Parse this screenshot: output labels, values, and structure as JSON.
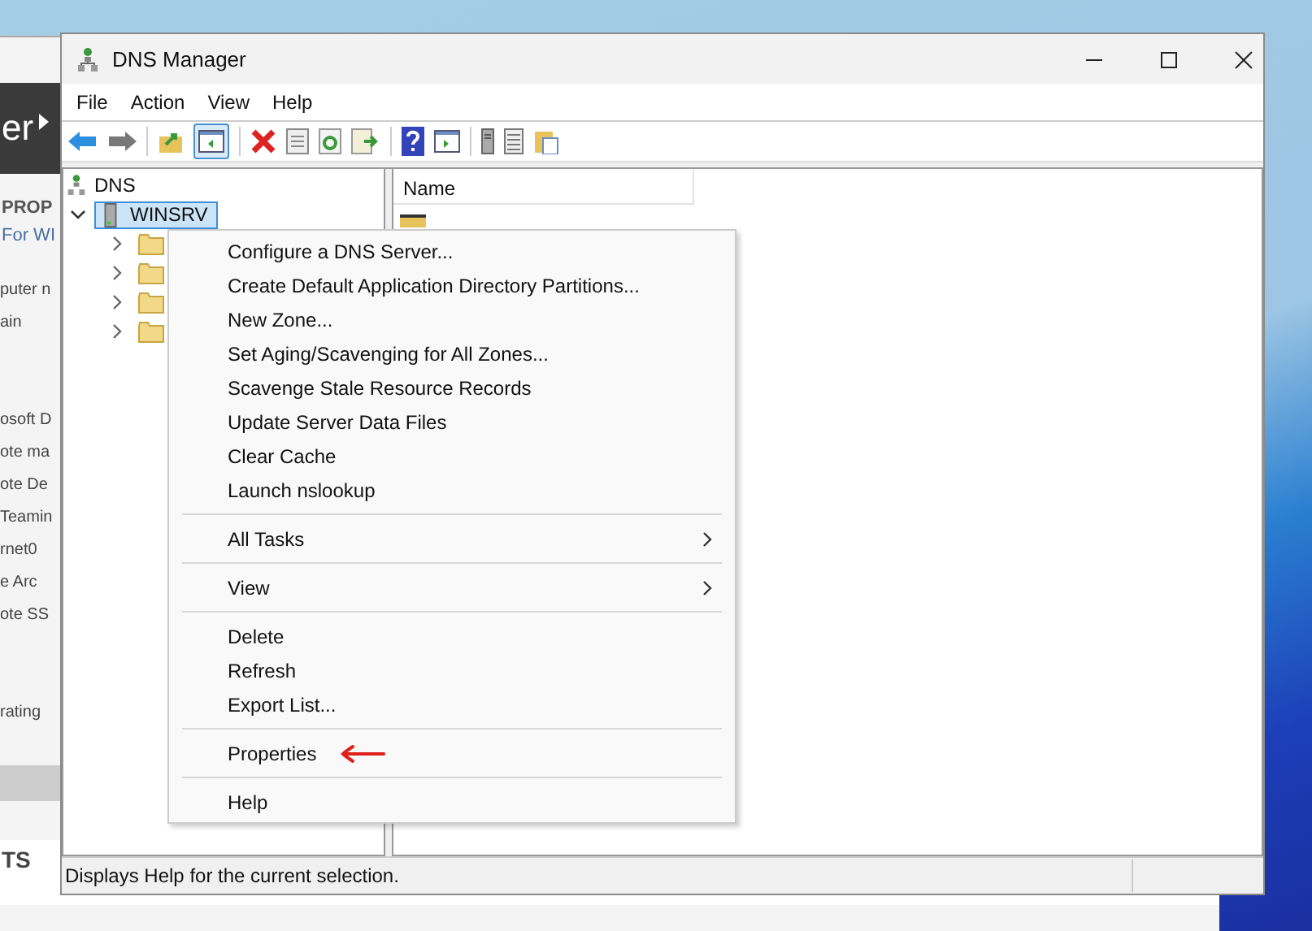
{
  "background_window": {
    "header": "er",
    "section_title": "PROP",
    "subtitle": "For WI",
    "line_groups": [
      [
        "puter n",
        "ain"
      ],
      [
        "osoft D",
        "ote ma",
        "ote De",
        "Teamin",
        "rnet0",
        "e Arc",
        "ote SS"
      ],
      [
        "rating"
      ]
    ],
    "footer_title": "TS"
  },
  "window": {
    "title": "DNS Manager"
  },
  "menu_bar": [
    "File",
    "Action",
    "View",
    "Help"
  ],
  "tree": {
    "label": "DNS",
    "children": [
      {
        "label": "WINSRV",
        "selected": true,
        "expanded": true,
        "children": [
          {
            "expanded": false
          },
          {
            "expanded": false
          },
          {
            "expanded": false
          },
          {
            "expanded": false
          }
        ]
      }
    ]
  },
  "list": {
    "columns": [
      "Name"
    ]
  },
  "context_menu": {
    "groups": [
      [
        {
          "label": "Configure a DNS Server...",
          "submenu": false,
          "marked": false
        },
        {
          "label": "Create Default Application Directory Partitions...",
          "submenu": false,
          "marked": false
        },
        {
          "label": "New Zone...",
          "submenu": false,
          "marked": false
        },
        {
          "label": "Set Aging/Scavenging for All Zones...",
          "submenu": false,
          "marked": false
        },
        {
          "label": "Scavenge Stale Resource Records",
          "submenu": false,
          "marked": false
        },
        {
          "label": "Update Server Data Files",
          "submenu": false,
          "marked": false
        },
        {
          "label": "Clear Cache",
          "submenu": false,
          "marked": false
        },
        {
          "label": "Launch nslookup",
          "submenu": false,
          "marked": false
        }
      ],
      [
        {
          "label": "All Tasks",
          "submenu": true,
          "marked": false
        }
      ],
      [
        {
          "label": "View",
          "submenu": true,
          "marked": false
        }
      ],
      [
        {
          "label": "Delete",
          "submenu": false,
          "marked": false
        },
        {
          "label": "Refresh",
          "submenu": false,
          "marked": false
        },
        {
          "label": "Export List...",
          "submenu": false,
          "marked": false
        }
      ],
      [
        {
          "label": "Properties",
          "submenu": false,
          "marked": true
        }
      ],
      [
        {
          "label": "Help",
          "submenu": false,
          "marked": false
        }
      ]
    ]
  },
  "status_bar": "Displays Help for the current selection."
}
